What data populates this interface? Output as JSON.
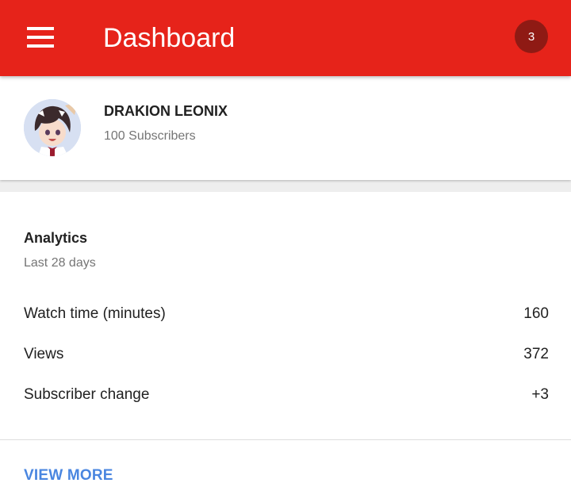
{
  "appbar": {
    "title": "Dashboard",
    "notification_count": "3",
    "color": "#e6231a"
  },
  "channel": {
    "name": "DRAKION LEONIX",
    "subscribers": "100 Subscribers"
  },
  "analytics": {
    "title": "Analytics",
    "period": "Last 28 days",
    "metrics": [
      {
        "label": "Watch time (minutes)",
        "value": "160"
      },
      {
        "label": "Views",
        "value": "372"
      },
      {
        "label": "Subscriber change",
        "value": "+3"
      }
    ],
    "view_more_label": "VIEW MORE",
    "link_color": "#4a86e0"
  }
}
